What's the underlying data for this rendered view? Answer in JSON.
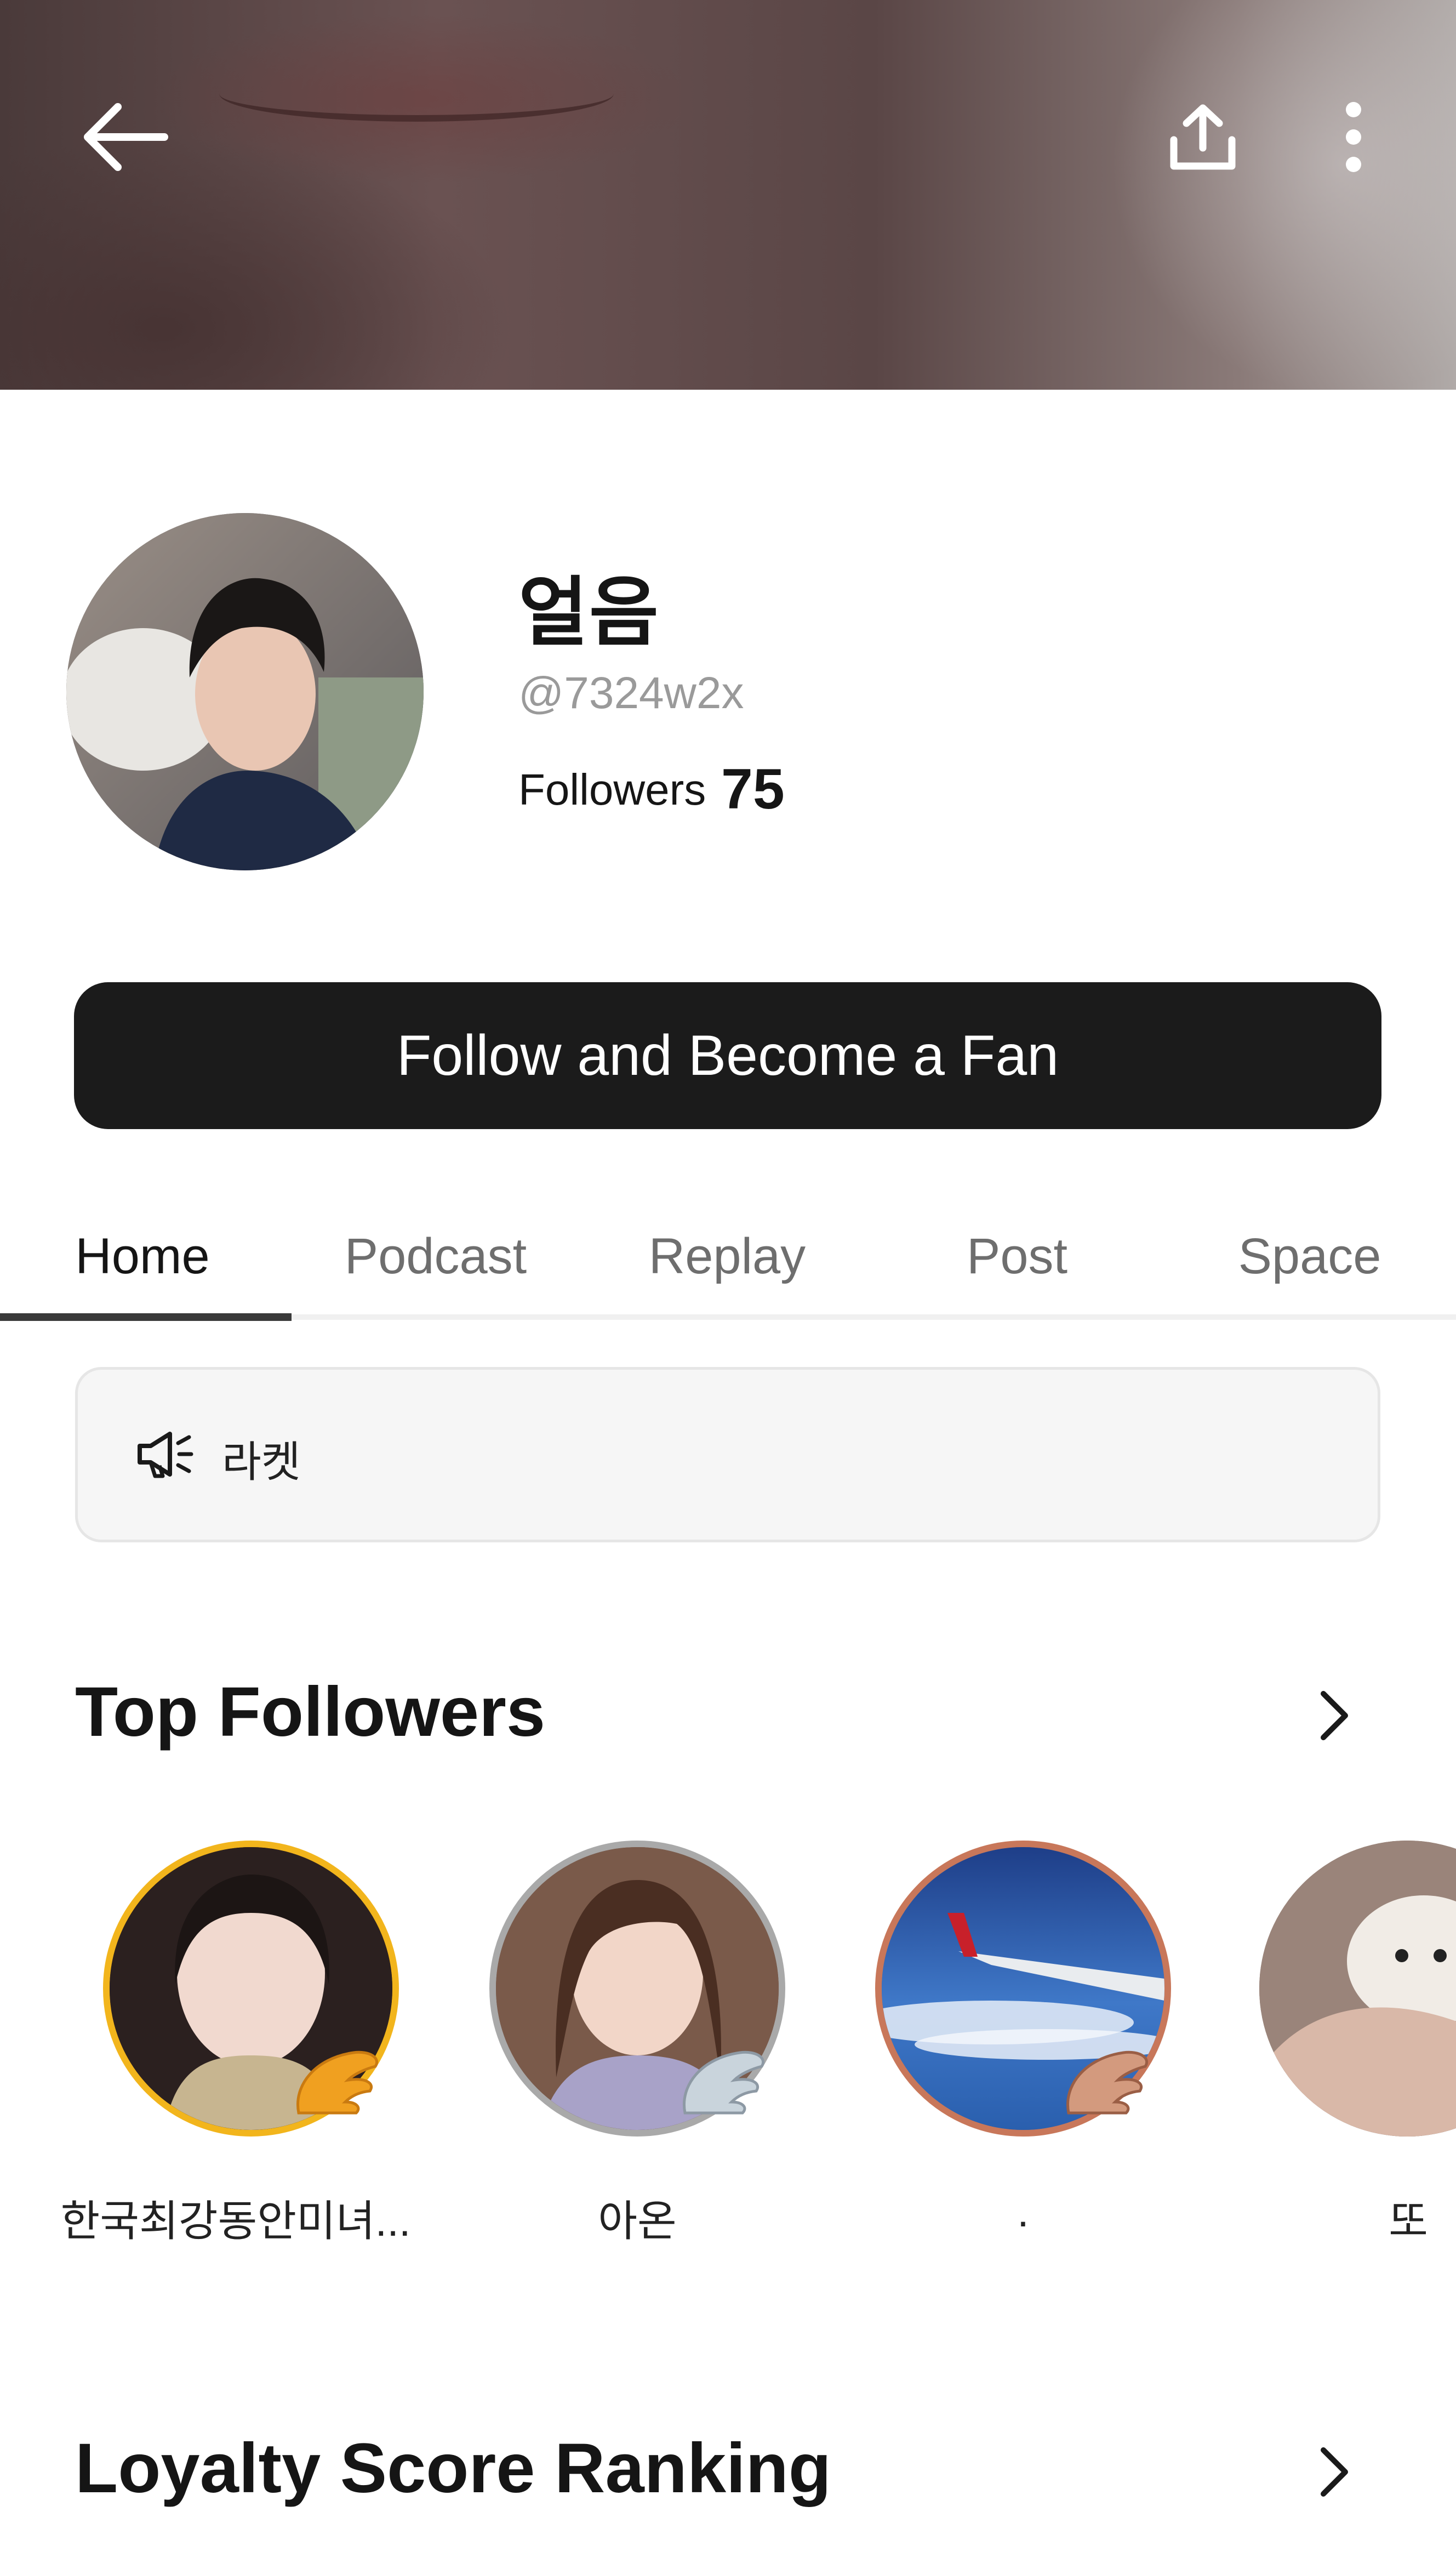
{
  "header": {
    "back_icon": "arrow-left-icon",
    "share_icon": "share-upload-icon",
    "more_icon": "more-vertical-icon"
  },
  "profile": {
    "name": "얼음",
    "handle": "@7324w2x",
    "followers_label": "Followers",
    "followers_count": "75"
  },
  "follow_button": {
    "label": "Follow and Become a Fan"
  },
  "tabs": [
    {
      "label": "Home",
      "active": true
    },
    {
      "label": "Podcast",
      "active": false
    },
    {
      "label": "Replay",
      "active": false
    },
    {
      "label": "Post",
      "active": false
    },
    {
      "label": "Space",
      "active": false
    }
  ],
  "notice": {
    "icon": "megaphone-icon",
    "text": "라켓"
  },
  "top_followers": {
    "title": "Top Followers",
    "items": [
      {
        "name": "한국최강동안미녀...",
        "ring": "#f2b51c",
        "badge": "gold-wing-badge"
      },
      {
        "name": "아온",
        "ring": "#a9a9a9",
        "badge": "silver-wing-badge"
      },
      {
        "name": ".",
        "ring": "#c8775a",
        "badge": "bronze-wing-badge"
      },
      {
        "name": "또",
        "ring": "none",
        "badge": ""
      }
    ]
  },
  "loyalty": {
    "title": "Loyalty Score Ranking"
  }
}
